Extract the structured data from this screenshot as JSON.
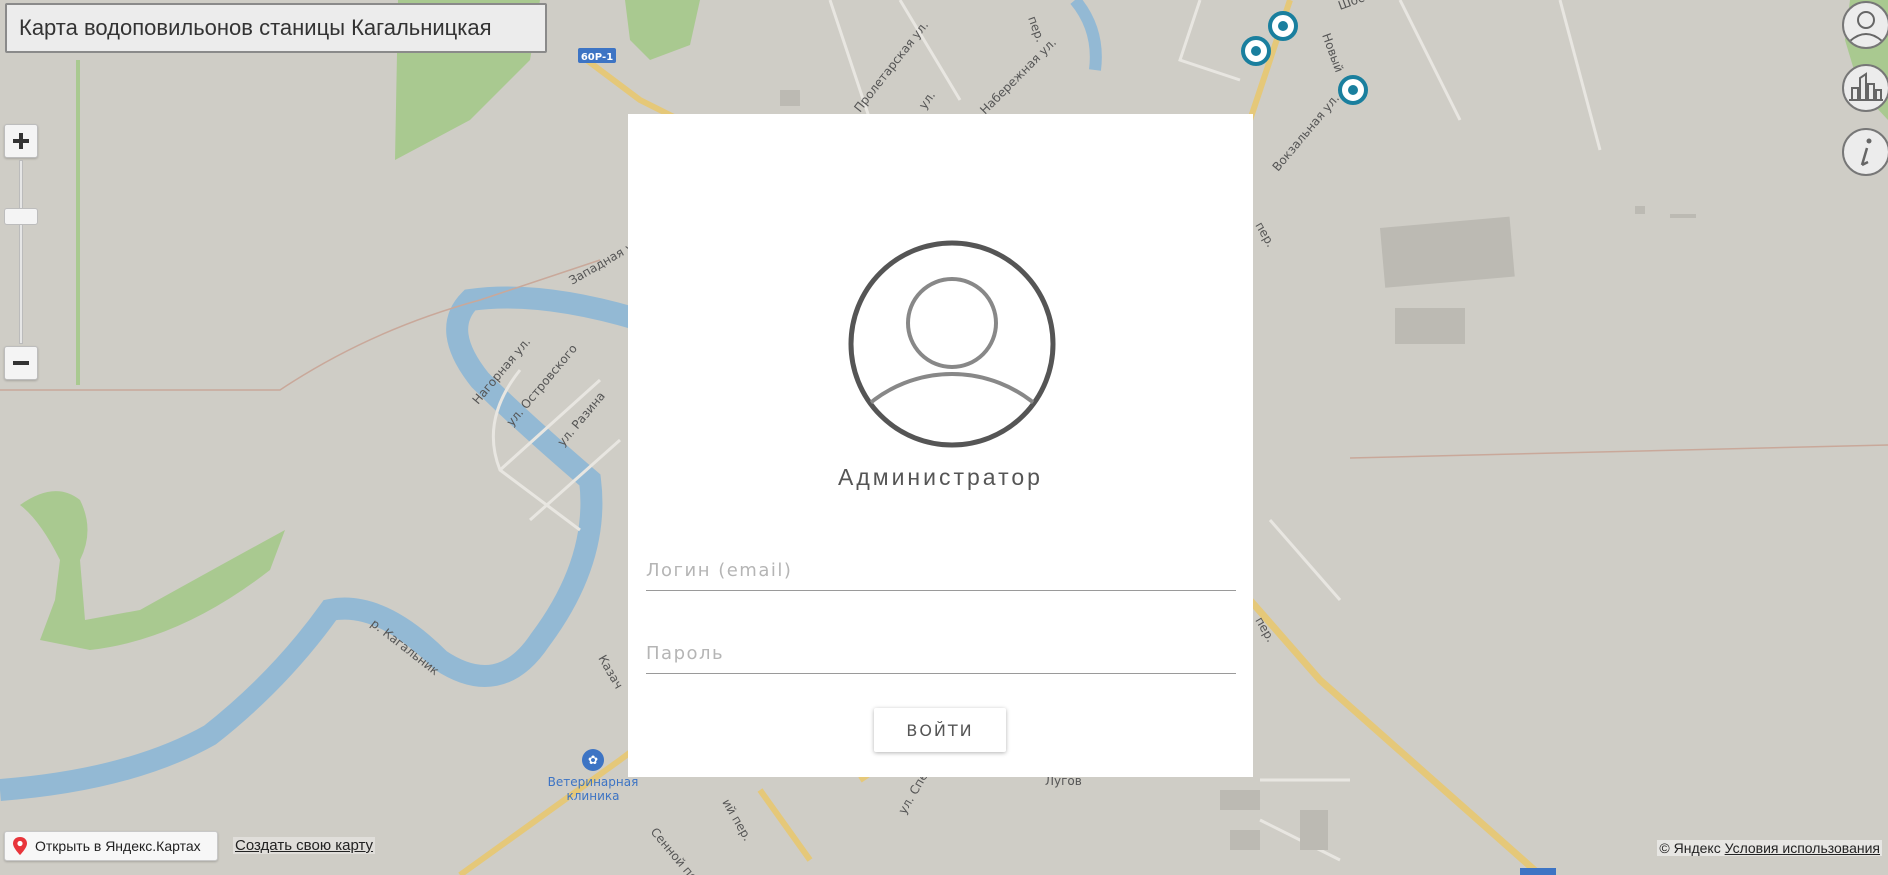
{
  "title": "Карта водоповильонов станицы Кагальницкая",
  "map": {
    "road_badge": "60Р-1",
    "streets": [
      "Пролетарская ул.",
      "ул.",
      "Набережная ул.",
      "пер.",
      "Шоссе",
      "Новый",
      "Вокзальная ул.",
      "Западная ул.",
      "Нагорная ул.",
      "ул. Островского",
      "ул. Разина",
      "р. Кагальник",
      "Казач",
      "Сенной пер.",
      "ий пер.",
      "ул. Спец",
      "Лугов",
      "пер.",
      "пер."
    ],
    "vet_clinic": "Ветеринарная клиника"
  },
  "colors": {
    "marker": "#1a7f9e",
    "water": "#93b9d4",
    "green": "#a9c990",
    "road": "#e5c879",
    "background": "#cfcdc6"
  },
  "icons": {
    "zoom_in": "plus-icon",
    "zoom_out": "minus-icon",
    "user": "user-icon",
    "city": "city-icon",
    "info": "info-icon",
    "location": "location-pin-icon"
  },
  "login": {
    "role": "Администратор",
    "login_placeholder": "Логин (email)",
    "password_placeholder": "Пароль",
    "login_value": "",
    "password_value": "",
    "submit_label": "ВОЙТИ"
  },
  "footer": {
    "open_in_yandex": "Открыть в Яндекс.Картах",
    "create_map": "Создать свою карту",
    "copyright": "© Яндекс",
    "terms": "Условия использования"
  }
}
